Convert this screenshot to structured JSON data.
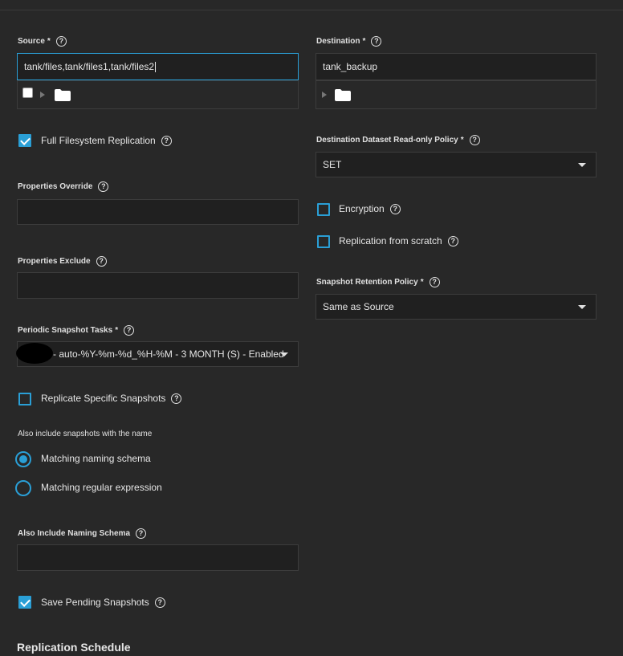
{
  "source": {
    "label": "Source",
    "required_mark": "*",
    "value": "tank/files,tank/files1,tank/files2"
  },
  "destination": {
    "label": "Destination",
    "required_mark": "*",
    "value": "tank_backup"
  },
  "full_filesystem_replication": {
    "label": "Full Filesystem Replication",
    "checked": true
  },
  "properties_override": {
    "label": "Properties Override",
    "value": ""
  },
  "properties_exclude": {
    "label": "Properties Exclude",
    "value": ""
  },
  "periodic_snapshot_tasks": {
    "label": "Periodic Snapshot Tasks",
    "required_mark": "*",
    "value": "- auto-%Y-%m-%d_%H-%M - 3 MONTH (S) - Enabled"
  },
  "replicate_specific_snapshots": {
    "label": "Replicate Specific Snapshots",
    "checked": false
  },
  "also_include_hint": "Also include snapshots with the name",
  "naming_options": [
    {
      "label": "Matching naming schema",
      "selected": true
    },
    {
      "label": "Matching regular expression",
      "selected": false
    }
  ],
  "also_include_naming_schema": {
    "label": "Also Include Naming Schema",
    "value": ""
  },
  "save_pending_snapshots": {
    "label": "Save Pending Snapshots",
    "checked": true
  },
  "destination_readonly_policy": {
    "label": "Destination Dataset Read-only Policy",
    "required_mark": "*",
    "value": "SET"
  },
  "encryption": {
    "label": "Encryption",
    "checked": false
  },
  "replication_from_scratch": {
    "label": "Replication from scratch",
    "checked": false
  },
  "snapshot_retention_policy": {
    "label": "Snapshot Retention Policy",
    "required_mark": "*",
    "value": "Same as Source"
  },
  "section": {
    "replication_schedule": "Replication Schedule"
  },
  "help_glyph": "?",
  "colors": {
    "accent": "#2a9fd6",
    "background": "#282828",
    "input_bg": "#202020"
  },
  "icons": {
    "help": "help-circle-icon",
    "folder": "folder-icon",
    "expand": "expand-triangle-icon",
    "dropdown": "chevron-down-icon"
  }
}
